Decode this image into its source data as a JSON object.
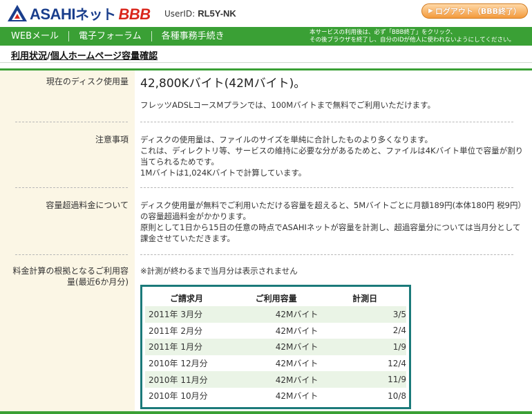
{
  "header": {
    "logo_brand": "ASAHI",
    "logo_net": "ネット",
    "logo_bbb": "BBB",
    "userid_label": "UserID:",
    "userid_value": "RL5Y-NK",
    "logout_label": "ログアウト（BBB終了）"
  },
  "nav": {
    "items": [
      "WEBメール",
      "電子フォーラム",
      "各種事務手続き"
    ],
    "note_line1": "本サービスの利用後は、必ず「BBB終了」をクリック、",
    "note_line2": "その後ブラウザを終了し、自分のIDが他人に使われないようにしてください。"
  },
  "breadcrumb": {
    "part1": "利用状況",
    "sep": "/",
    "part2": "個人ホームページ容量確認"
  },
  "sections": [
    {
      "label": "現在のディスク使用量",
      "headline": "42,800Kバイト(42Mバイト)。",
      "lines": [
        "フレッツADSLコースMプランでは、100Mバイトまで無料でご利用いただけます。"
      ]
    },
    {
      "label": "注意事項",
      "lines": [
        "ディスクの使用量は、ファイルのサイズを単純に合計したものより多くなります。",
        "これは、ディレクトリ等、サービスの維持に必要な分があるためと、ファイルは4Kバイト単位で容量が割り当てられるためです。",
        "1Mバイトは1,024Kバイトで計算しています。"
      ]
    },
    {
      "label": "容量超過料金について",
      "lines": [
        "ディスク使用量が無料でご利用いただける容量を超えると、5Mバイトごとに月額189円(本体180円 税9円）の容量超過料金がかかります。",
        "原則として1日から15日の任意の時点でASAHIネットが容量を計測し、超過容量分については当月分として課金させていただきます。"
      ]
    },
    {
      "label_line1": "料金計算の根拠となるご利用容",
      "label_line2": "量(最近6か月分)",
      "note": "※計測が終わるまで当月分は表示されません"
    }
  ],
  "usage_table": {
    "headers": [
      "ご請求月",
      "ご利用容量",
      "計測日"
    ],
    "rows": [
      {
        "month": "2011年 3月分",
        "usage": "42Mバイト",
        "date": "3/5"
      },
      {
        "month": "2011年 2月分",
        "usage": "42Mバイト",
        "date": "2/4"
      },
      {
        "month": "2011年 1月分",
        "usage": "42Mバイト",
        "date": "1/9"
      },
      {
        "month": "2010年 12月分",
        "usage": "42Mバイト",
        "date": "12/4"
      },
      {
        "month": "2010年 11月分",
        "usage": "42Mバイト",
        "date": "11/9"
      },
      {
        "month": "2010年 10月分",
        "usage": "42Mバイト",
        "date": "10/8"
      }
    ]
  },
  "colors": {
    "brand_blue": "#1a3e8c",
    "brand_red": "#d9261c",
    "nav_green": "#3aa035",
    "label_bg": "#fbf6e5",
    "table_border": "#1b7a7a",
    "logout_orange": "#f39a3c"
  }
}
